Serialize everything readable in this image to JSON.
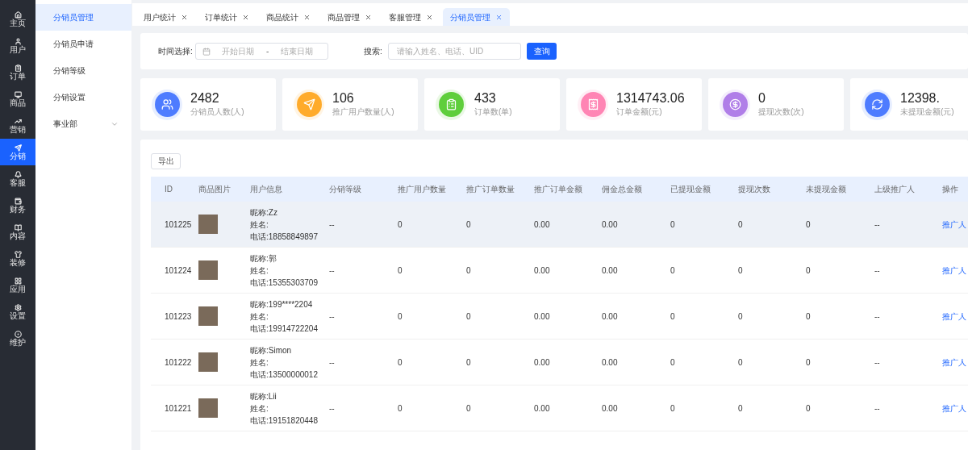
{
  "nav": [
    {
      "label": "主页",
      "selected": false
    },
    {
      "label": "用户",
      "selected": false
    },
    {
      "label": "订单",
      "selected": false
    },
    {
      "label": "商品",
      "selected": false
    },
    {
      "label": "营销",
      "selected": false
    },
    {
      "label": "分销",
      "selected": true
    },
    {
      "label": "客服",
      "selected": false
    },
    {
      "label": "财务",
      "selected": false
    },
    {
      "label": "内容",
      "selected": false
    },
    {
      "label": "装修",
      "selected": false
    },
    {
      "label": "应用",
      "selected": false
    },
    {
      "label": "设置",
      "selected": false
    },
    {
      "label": "维护",
      "selected": false
    }
  ],
  "submenu": [
    {
      "label": "分销员管理",
      "selected": true
    },
    {
      "label": "分销员申请",
      "selected": false
    },
    {
      "label": "分销等级",
      "selected": false
    },
    {
      "label": "分销设置",
      "selected": false
    },
    {
      "label": "事业部",
      "selected": false,
      "expanded": false
    }
  ],
  "tabs": [
    {
      "label": "用户统计",
      "selected": false
    },
    {
      "label": "订单统计",
      "selected": false
    },
    {
      "label": "商品统计",
      "selected": false
    },
    {
      "label": "商品管理",
      "selected": false
    },
    {
      "label": "客服管理",
      "selected": false
    },
    {
      "label": "分销员管理",
      "selected": true
    }
  ],
  "filter": {
    "date_label": "时间选择:",
    "start_placeholder": "开始日期",
    "separator": "-",
    "end_placeholder": "结束日期",
    "search_label": "搜索:",
    "search_placeholder": "请输入姓名、电话、UID",
    "query_button": "查询"
  },
  "stats": [
    {
      "value": "2482",
      "label": "分销员人数(人)",
      "color": "#4e7cff"
    },
    {
      "value": "106",
      "label": "推广用户数量(人)",
      "color": "#ffab2b"
    },
    {
      "value": "433",
      "label": "订单数(单)",
      "color": "#5fce3c"
    },
    {
      "value": "1314743.06",
      "label": "订单金额(元)",
      "color": "#ff85b4"
    },
    {
      "value": "0",
      "label": "提现次数(次)",
      "color": "#b07ee8"
    },
    {
      "value": "12398.",
      "label": "未提现金额(元)",
      "color": "#4e7cff"
    }
  ],
  "export_button": "导出",
  "table": {
    "columns": [
      "ID",
      "商品图片",
      "用户信息",
      "分销等级",
      "推广用户数量",
      "推广订单数量",
      "推广订单金额",
      "佣金总金额",
      "已提现金额",
      "提现次数",
      "未提现金额",
      "上级推广人",
      "操作"
    ],
    "rows": [
      {
        "selected": true,
        "id": "101225",
        "nickname": "昵称:Zz",
        "name": "姓名:",
        "phone": "电话:18858849897",
        "level": "--",
        "promo_users": "0",
        "promo_orders": "0",
        "order_amount": "0.00",
        "commission": "0.00",
        "withdrawn": "0",
        "withdraw_count": "0",
        "unwithdrawn": "0",
        "superior": "--",
        "action": "推广人"
      },
      {
        "selected": false,
        "id": "101224",
        "nickname": "昵称:郭",
        "name": "姓名:",
        "phone": "电话:15355303709",
        "level": "--",
        "promo_users": "0",
        "promo_orders": "0",
        "order_amount": "0.00",
        "commission": "0.00",
        "withdrawn": "0",
        "withdraw_count": "0",
        "unwithdrawn": "0",
        "superior": "--",
        "action": "推广人"
      },
      {
        "selected": false,
        "id": "101223",
        "nickname": "昵称:199****2204",
        "name": "姓名:",
        "phone": "电话:19914722204",
        "level": "--",
        "promo_users": "0",
        "promo_orders": "0",
        "order_amount": "0.00",
        "commission": "0.00",
        "withdrawn": "0",
        "withdraw_count": "0",
        "unwithdrawn": "0",
        "superior": "--",
        "action": "推广人"
      },
      {
        "selected": false,
        "id": "101222",
        "nickname": "昵称:Simon",
        "name": "姓名:",
        "phone": "电话:13500000012",
        "level": "--",
        "promo_users": "0",
        "promo_orders": "0",
        "order_amount": "0.00",
        "commission": "0.00",
        "withdrawn": "0",
        "withdraw_count": "0",
        "unwithdrawn": "0",
        "superior": "--",
        "action": "推广人"
      },
      {
        "selected": false,
        "id": "101221",
        "nickname": "昵称:Lii",
        "name": "姓名:",
        "phone": "电话:19151820448",
        "level": "--",
        "promo_users": "0",
        "promo_orders": "0",
        "order_amount": "0.00",
        "commission": "0.00",
        "withdrawn": "0",
        "withdraw_count": "0",
        "unwithdrawn": "0",
        "superior": "--",
        "action": "推广人"
      }
    ]
  }
}
